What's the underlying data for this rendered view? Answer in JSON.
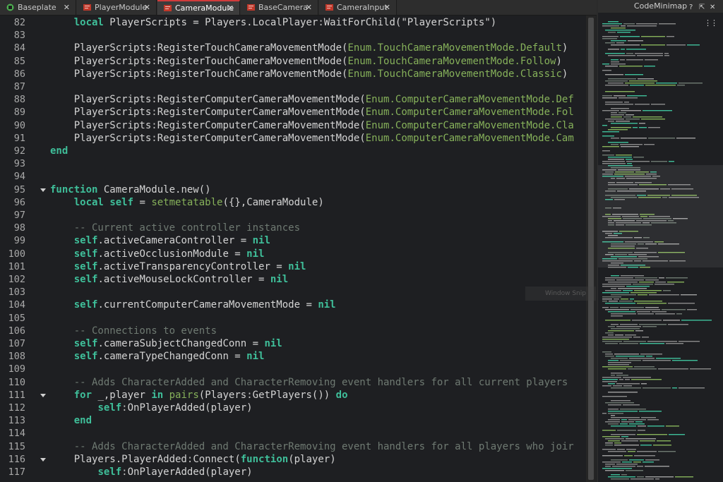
{
  "tabs": [
    {
      "label": "Baseplate",
      "icon": "roblox-place-icon",
      "active": false
    },
    {
      "label": "PlayerModule",
      "icon": "module-script-icon",
      "active": false
    },
    {
      "label": "CameraModule",
      "icon": "module-script-icon",
      "active": true
    },
    {
      "label": "BaseCamera",
      "icon": "module-script-icon",
      "active": false
    },
    {
      "label": "CameraInput",
      "icon": "module-script-icon",
      "active": false
    }
  ],
  "close_glyph": "✕",
  "minimap": {
    "title": "CodeMinimap",
    "more_glyph": "⋮⋮"
  },
  "tooltip": "Window Snip",
  "colors": {
    "keyword": "#3fbf9a",
    "enum": "#86b15a",
    "comment": "#6f7a72",
    "active_tab_accent": "#d13b3b"
  },
  "lines": [
    {
      "n": "82",
      "fold": false,
      "code": [
        [
          "t",
          "    "
        ],
        [
          "kw",
          "local"
        ],
        [
          "t",
          " PlayerScripts = Players.LocalPlayer"
        ],
        [
          "op",
          ":"
        ],
        [
          "t",
          "WaitForChild(\"PlayerScripts\")"
        ]
      ]
    },
    {
      "n": "83",
      "fold": false,
      "code": []
    },
    {
      "n": "84",
      "fold": false,
      "code": [
        [
          "t",
          "    PlayerScripts"
        ],
        [
          "op",
          ":"
        ],
        [
          "t",
          "RegisterTouchCameraMovementMode("
        ],
        [
          "en",
          "Enum.TouchCameraMovementMode.Default"
        ],
        [
          "t",
          ")"
        ]
      ]
    },
    {
      "n": "85",
      "fold": false,
      "code": [
        [
          "t",
          "    PlayerScripts"
        ],
        [
          "op",
          ":"
        ],
        [
          "t",
          "RegisterTouchCameraMovementMode("
        ],
        [
          "en",
          "Enum.TouchCameraMovementMode.Follow"
        ],
        [
          "t",
          ")"
        ]
      ]
    },
    {
      "n": "86",
      "fold": false,
      "code": [
        [
          "t",
          "    PlayerScripts"
        ],
        [
          "op",
          ":"
        ],
        [
          "t",
          "RegisterTouchCameraMovementMode("
        ],
        [
          "en",
          "Enum.TouchCameraMovementMode.Classic"
        ],
        [
          "t",
          ")"
        ]
      ]
    },
    {
      "n": "87",
      "fold": false,
      "code": []
    },
    {
      "n": "88",
      "fold": false,
      "code": [
        [
          "t",
          "    PlayerScripts"
        ],
        [
          "op",
          ":"
        ],
        [
          "t",
          "RegisterComputerCameraMovementMode("
        ],
        [
          "en",
          "Enum.ComputerCameraMovementMode.Def"
        ]
      ]
    },
    {
      "n": "89",
      "fold": false,
      "code": [
        [
          "t",
          "    PlayerScripts"
        ],
        [
          "op",
          ":"
        ],
        [
          "t",
          "RegisterComputerCameraMovementMode("
        ],
        [
          "en",
          "Enum.ComputerCameraMovementMode.Fol"
        ]
      ]
    },
    {
      "n": "90",
      "fold": false,
      "code": [
        [
          "t",
          "    PlayerScripts"
        ],
        [
          "op",
          ":"
        ],
        [
          "t",
          "RegisterComputerCameraMovementMode("
        ],
        [
          "en",
          "Enum.ComputerCameraMovementMode.Cla"
        ]
      ]
    },
    {
      "n": "91",
      "fold": false,
      "code": [
        [
          "t",
          "    PlayerScripts"
        ],
        [
          "op",
          ":"
        ],
        [
          "t",
          "RegisterComputerCameraMovementMode("
        ],
        [
          "en",
          "Enum.ComputerCameraMovementMode.Cam"
        ]
      ]
    },
    {
      "n": "92",
      "fold": false,
      "code": [
        [
          "kw",
          "end"
        ]
      ]
    },
    {
      "n": "93",
      "fold": false,
      "code": []
    },
    {
      "n": "94",
      "fold": false,
      "code": []
    },
    {
      "n": "95",
      "fold": true,
      "code": [
        [
          "kw",
          "function"
        ],
        [
          "t",
          " CameraModule.new()"
        ]
      ]
    },
    {
      "n": "96",
      "fold": false,
      "code": [
        [
          "t",
          "    "
        ],
        [
          "kw",
          "local"
        ],
        [
          "t",
          " "
        ],
        [
          "kw",
          "self"
        ],
        [
          "t",
          " = "
        ],
        [
          "en",
          "setmetatable"
        ],
        [
          "t",
          "({},CameraModule)"
        ]
      ]
    },
    {
      "n": "97",
      "fold": false,
      "code": []
    },
    {
      "n": "98",
      "fold": false,
      "code": [
        [
          "cm",
          "    -- Current active controller instances"
        ]
      ]
    },
    {
      "n": "99",
      "fold": false,
      "code": [
        [
          "t",
          "    "
        ],
        [
          "kw",
          "self"
        ],
        [
          "t",
          ".activeCameraController = "
        ],
        [
          "kw",
          "nil"
        ]
      ]
    },
    {
      "n": "100",
      "fold": false,
      "code": [
        [
          "t",
          "    "
        ],
        [
          "kw",
          "self"
        ],
        [
          "t",
          ".activeOcclusionModule = "
        ],
        [
          "kw",
          "nil"
        ]
      ]
    },
    {
      "n": "101",
      "fold": false,
      "code": [
        [
          "t",
          "    "
        ],
        [
          "kw",
          "self"
        ],
        [
          "t",
          ".activeTransparencyController = "
        ],
        [
          "kw",
          "nil"
        ]
      ]
    },
    {
      "n": "102",
      "fold": false,
      "code": [
        [
          "t",
          "    "
        ],
        [
          "kw",
          "self"
        ],
        [
          "t",
          ".activeMouseLockController = "
        ],
        [
          "kw",
          "nil"
        ]
      ]
    },
    {
      "n": "103",
      "fold": false,
      "code": []
    },
    {
      "n": "104",
      "fold": false,
      "code": [
        [
          "t",
          "    "
        ],
        [
          "kw",
          "self"
        ],
        [
          "t",
          ".currentComputerCameraMovementMode = "
        ],
        [
          "kw",
          "nil"
        ]
      ]
    },
    {
      "n": "105",
      "fold": false,
      "code": []
    },
    {
      "n": "106",
      "fold": false,
      "code": [
        [
          "cm",
          "    -- Connections to events"
        ]
      ]
    },
    {
      "n": "107",
      "fold": false,
      "code": [
        [
          "t",
          "    "
        ],
        [
          "kw",
          "self"
        ],
        [
          "t",
          ".cameraSubjectChangedConn = "
        ],
        [
          "kw",
          "nil"
        ]
      ]
    },
    {
      "n": "108",
      "fold": false,
      "code": [
        [
          "t",
          "    "
        ],
        [
          "kw",
          "self"
        ],
        [
          "t",
          ".cameraTypeChangedConn = "
        ],
        [
          "kw",
          "nil"
        ]
      ]
    },
    {
      "n": "109",
      "fold": false,
      "code": []
    },
    {
      "n": "110",
      "fold": false,
      "code": [
        [
          "cm",
          "    -- Adds CharacterAdded and CharacterRemoving event handlers for all current players"
        ]
      ]
    },
    {
      "n": "111",
      "fold": true,
      "code": [
        [
          "t",
          "    "
        ],
        [
          "kw",
          "for"
        ],
        [
          "t",
          " _,player "
        ],
        [
          "kw",
          "in"
        ],
        [
          "t",
          " "
        ],
        [
          "en",
          "pairs"
        ],
        [
          "t",
          "(Players"
        ],
        [
          "op",
          ":"
        ],
        [
          "t",
          "GetPlayers()) "
        ],
        [
          "kw",
          "do"
        ]
      ]
    },
    {
      "n": "112",
      "fold": false,
      "code": [
        [
          "t",
          "        "
        ],
        [
          "kw",
          "self"
        ],
        [
          "op",
          ":"
        ],
        [
          "t",
          "OnPlayerAdded(player)"
        ]
      ]
    },
    {
      "n": "113",
      "fold": false,
      "code": [
        [
          "t",
          "    "
        ],
        [
          "kw",
          "end"
        ]
      ]
    },
    {
      "n": "114",
      "fold": false,
      "code": []
    },
    {
      "n": "115",
      "fold": false,
      "code": [
        [
          "cm",
          "    -- Adds CharacterAdded and CharacterRemoving event handlers for all players who joir"
        ]
      ]
    },
    {
      "n": "116",
      "fold": true,
      "code": [
        [
          "t",
          "    Players.PlayerAdded"
        ],
        [
          "op",
          ":"
        ],
        [
          "t",
          "Connect("
        ],
        [
          "kw",
          "function"
        ],
        [
          "t",
          "(player)"
        ]
      ]
    },
    {
      "n": "117",
      "fold": false,
      "code": [
        [
          "t",
          "        "
        ],
        [
          "kw",
          "self"
        ],
        [
          "op",
          ":"
        ],
        [
          "t",
          "OnPlayerAdded(player)"
        ]
      ]
    }
  ]
}
